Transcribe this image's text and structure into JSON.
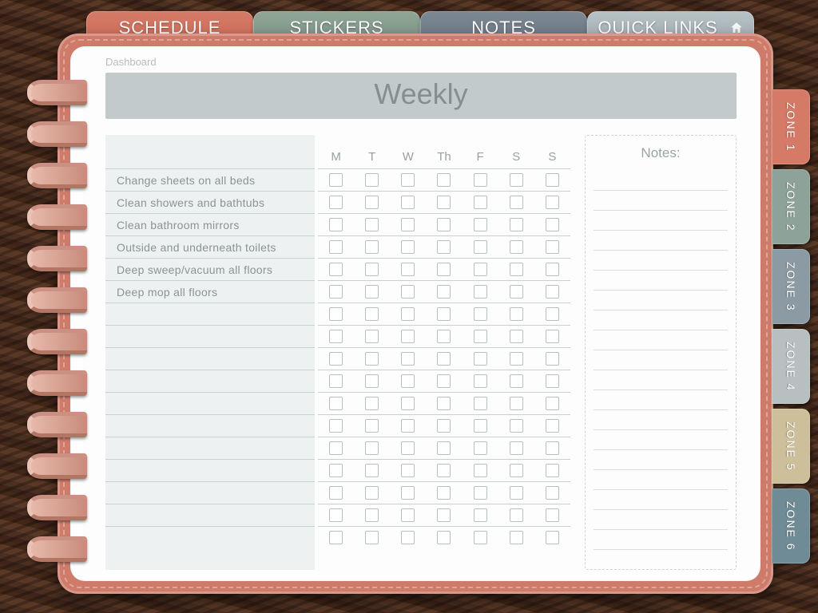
{
  "top_tabs": {
    "schedule": "SCHEDULE",
    "stickers": "STICKERS",
    "notes": "NOTES",
    "quick_links": "QUICK LINKS"
  },
  "breadcrumb": "Dashboard",
  "title": "Weekly",
  "days": [
    "M",
    "T",
    "W",
    "Th",
    "F",
    "S",
    "S"
  ],
  "tasks": [
    "Change sheets on all beds",
    "Clean showers and bathtubs",
    "Clean bathroom mirrors",
    "Outside and underneath toilets",
    "Deep sweep/vacuum all floors",
    "Deep mop all floors",
    "",
    "",
    "",
    "",
    "",
    "",
    "",
    "",
    "",
    "",
    ""
  ],
  "notes_label": "Notes:",
  "side_tabs": [
    {
      "label": "ZONE 1",
      "cls": "z1"
    },
    {
      "label": "ZONE 2",
      "cls": "z2"
    },
    {
      "label": "ZONE 3",
      "cls": "z3"
    },
    {
      "label": "ZONE 4",
      "cls": "z4"
    },
    {
      "label": "ZONE 5",
      "cls": "z5"
    },
    {
      "label": "ZONE 6",
      "cls": "z6"
    }
  ],
  "ring_count": 12,
  "note_line_count": 19
}
